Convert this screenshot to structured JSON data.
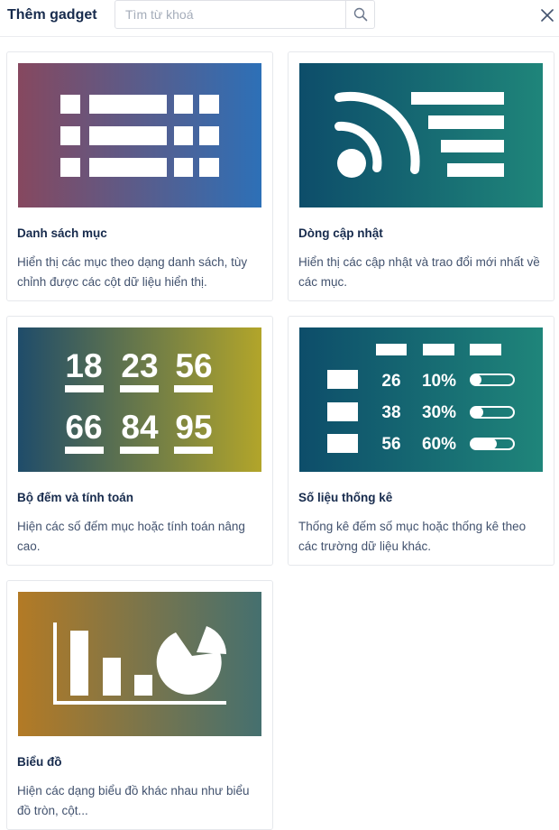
{
  "dialog": {
    "title": "Thêm gadget",
    "search_placeholder": "Tìm từ khoá",
    "search_value": ""
  },
  "gadgets": [
    {
      "name": "Danh sách mục",
      "description": "Hiển thị các mục theo dạng danh sách, tùy chỉnh được các cột dữ liệu hiển thị.",
      "gradient": [
        "#86485f",
        "#2d70b7"
      ]
    },
    {
      "name": "Dòng cập nhật",
      "description": "Hiển thị các cập nhật và trao đổi mới nhất về các mục.",
      "gradient": [
        "#0d4d6a",
        "#1f857a"
      ]
    },
    {
      "name": "Bộ đếm và tính toán",
      "description": "Hiện các số đếm mục hoặc tính toán nâng cao.",
      "gradient": [
        "#1f4c6a",
        "#b2a52a"
      ],
      "counters": [
        "18",
        "23",
        "56",
        "66",
        "84",
        "95"
      ]
    },
    {
      "name": "Số liệu thống kê",
      "description": "Thống kê đếm số mục hoặc thống kê theo các trường dữ liệu khác.",
      "gradient": [
        "#0d4d6a",
        "#1f857a"
      ],
      "stats": [
        {
          "count": "26",
          "percent": "10%",
          "fill": 0.1
        },
        {
          "count": "38",
          "percent": "30%",
          "fill": 0.3
        },
        {
          "count": "56",
          "percent": "60%",
          "fill": 0.6
        }
      ]
    },
    {
      "name": "Biểu đồ",
      "description": "Hiện các dạng biểu đồ khác nhau như biểu đồ tròn, cột...",
      "gradient": [
        "#b37a25",
        "#45706f"
      ]
    }
  ],
  "icons": {
    "search": "search-icon",
    "close": "close-icon"
  }
}
